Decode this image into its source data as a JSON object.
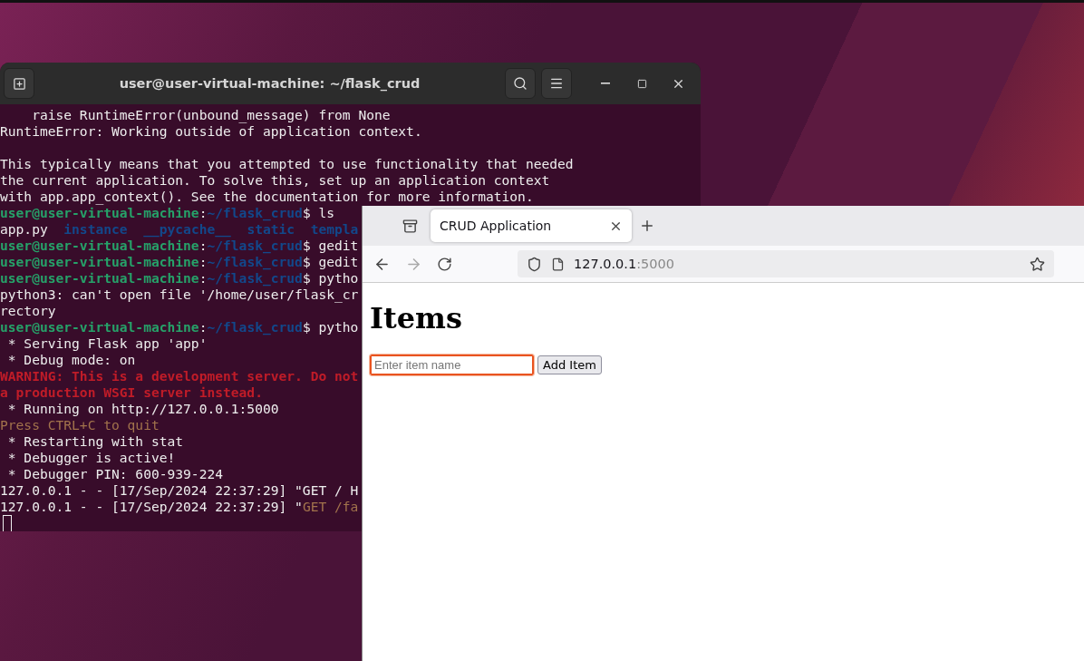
{
  "terminal": {
    "title": "user@user-virtual-machine: ~/flask_crud",
    "lines": [
      {
        "kind": "segments",
        "segments": [
          {
            "kind": "text",
            "text": "    raise RuntimeError(unbound_message) from None"
          }
        ]
      },
      {
        "kind": "segments",
        "segments": [
          {
            "kind": "text",
            "text": "RuntimeError: Working outside of application context."
          }
        ]
      },
      {
        "kind": "blank"
      },
      [
        {
          "kind": "text",
          "text": "This typically means that you attempted to use functionality that needed"
        }
      ],
      [
        {
          "kind": "text",
          "text": "the current application. To solve this, set up an application context"
        }
      ],
      [
        {
          "kind": "text",
          "text": "with app.app_context(). See the documentation for more information."
        }
      ],
      [
        {
          "kind": "user",
          "text": "user@user-virtual-machine"
        },
        {
          "kind": "text",
          "text": ":"
        },
        {
          "kind": "path",
          "text": "~/flask_crud"
        },
        {
          "kind": "text",
          "text": "$ ls"
        }
      ],
      [
        {
          "kind": "text",
          "text": "app.py  "
        },
        {
          "kind": "path",
          "text": "instance  __pycache__  static  templa"
        }
      ],
      [
        {
          "kind": "user",
          "text": "user@user-virtual-machine"
        },
        {
          "kind": "text",
          "text": ":"
        },
        {
          "kind": "path",
          "text": "~/flask_crud"
        },
        {
          "kind": "text",
          "text": "$ gedit"
        }
      ],
      [
        {
          "kind": "user",
          "text": "user@user-virtual-machine"
        },
        {
          "kind": "text",
          "text": ":"
        },
        {
          "kind": "path",
          "text": "~/flask_crud"
        },
        {
          "kind": "text",
          "text": "$ gedit"
        }
      ],
      [
        {
          "kind": "user",
          "text": "user@user-virtual-machine"
        },
        {
          "kind": "text",
          "text": ":"
        },
        {
          "kind": "path",
          "text": "~/flask_crud"
        },
        {
          "kind": "text",
          "text": "$ pytho"
        }
      ],
      [
        {
          "kind": "text",
          "text": "python3: can't open file '/home/user/flask_cr"
        }
      ],
      [
        {
          "kind": "text",
          "text": "rectory"
        }
      ],
      [
        {
          "kind": "user",
          "text": "user@user-virtual-machine"
        },
        {
          "kind": "text",
          "text": ":"
        },
        {
          "kind": "path",
          "text": "~/flask_crud"
        },
        {
          "kind": "text",
          "text": "$ pytho"
        }
      ],
      [
        {
          "kind": "text",
          "text": " * Serving Flask app 'app'"
        }
      ],
      [
        {
          "kind": "text",
          "text": " * Debug mode: on"
        }
      ],
      [
        {
          "kind": "error",
          "text": "WARNING: This is a development server. Do not"
        }
      ],
      [
        {
          "kind": "error",
          "text": "a production WSGI server instead."
        }
      ],
      [
        {
          "kind": "text",
          "text": " * Running on http://127.0.0.1:5000"
        }
      ],
      [
        {
          "kind": "dim",
          "text": "Press CTRL+C to quit"
        }
      ],
      [
        {
          "kind": "text",
          "text": " * Restarting with stat"
        }
      ],
      [
        {
          "kind": "text",
          "text": " * Debugger is active!"
        }
      ],
      [
        {
          "kind": "text",
          "text": " * Debugger PIN: 600-939-224"
        }
      ],
      [
        {
          "kind": "text",
          "text": "127.0.0.1 - - [17/Sep/2024 22:37:29] \"GET / H"
        }
      ],
      [
        {
          "kind": "text",
          "text": "127.0.0.1 - - [17/Sep/2024 22:37:29] \""
        },
        {
          "kind": "dim",
          "text": "GET /fa"
        }
      ]
    ]
  },
  "browser": {
    "tabs": [
      {
        "label": "CRUD Application",
        "selected": true
      }
    ],
    "address": {
      "host": "127.0.0.1",
      "port": ":5000"
    },
    "page": {
      "heading": "Items",
      "input": {
        "placeholder": "Enter item name"
      },
      "button": "Add Item"
    }
  }
}
